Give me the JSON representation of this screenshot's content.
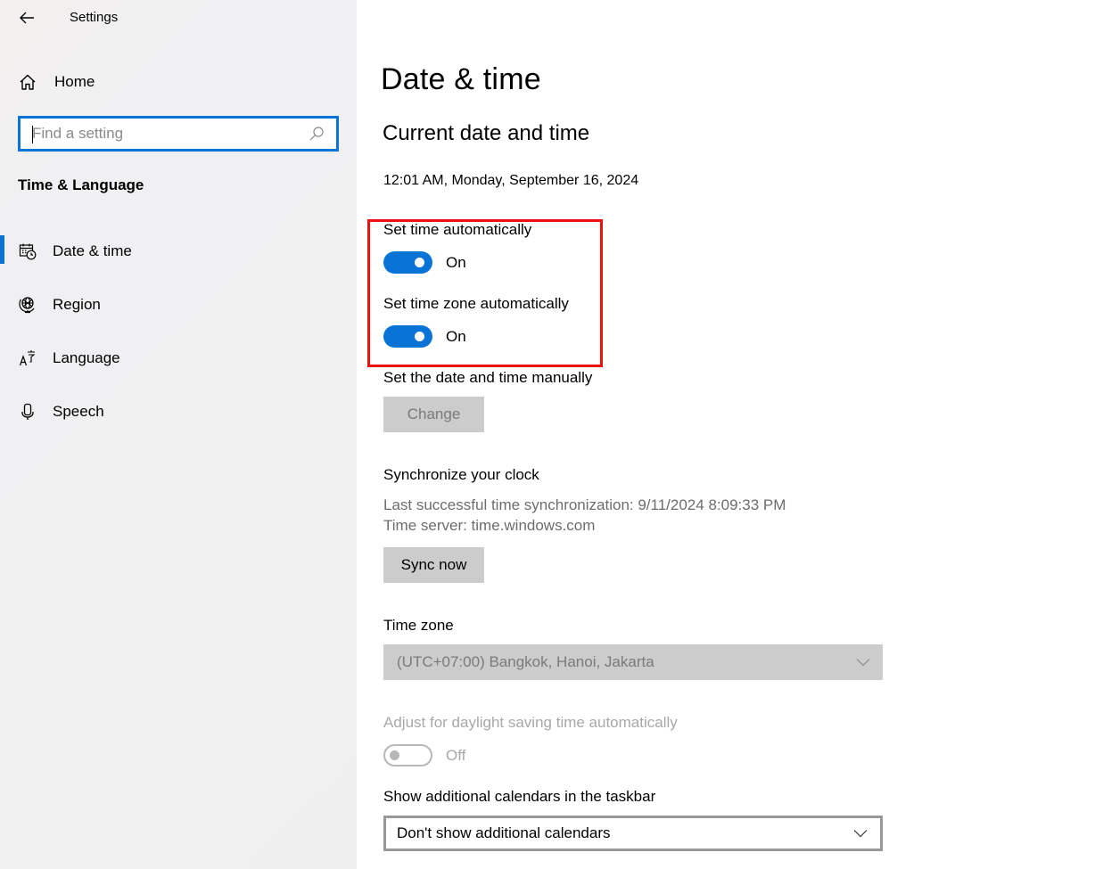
{
  "window": {
    "app_title": "Settings",
    "back_icon": "back-arrow-icon"
  },
  "sidebar": {
    "home": {
      "label": "Home",
      "icon": "home-icon"
    },
    "search": {
      "placeholder": "Find a setting",
      "value": "",
      "icon": "search-icon"
    },
    "section_title": "Time & Language",
    "items": [
      {
        "label": "Date & time",
        "icon": "calendar-clock-icon",
        "active": true
      },
      {
        "label": "Region",
        "icon": "globe-icon",
        "active": false
      },
      {
        "label": "Language",
        "icon": "language-icon",
        "active": false
      },
      {
        "label": "Speech",
        "icon": "microphone-icon",
        "active": false
      }
    ],
    "accent_color": "#0a74d6"
  },
  "main": {
    "page_title": "Date & time",
    "section_title": "Current date and time",
    "current_datetime": "12:01 AM, Monday, September 16, 2024",
    "set_time_auto": {
      "label": "Set time automatically",
      "state": "On",
      "enabled": true
    },
    "set_timezone_auto": {
      "label": "Set time zone automatically",
      "state": "On",
      "enabled": true
    },
    "manual": {
      "label": "Set the date and time manually",
      "button": "Change",
      "button_disabled": true
    },
    "sync": {
      "title": "Synchronize your clock",
      "last_sync": "Last successful time synchronization: 9/11/2024 8:09:33 PM",
      "server": "Time server: time.windows.com",
      "button": "Sync now"
    },
    "timezone": {
      "label": "Time zone",
      "value": "(UTC+07:00) Bangkok, Hanoi, Jakarta",
      "disabled": true
    },
    "dst": {
      "label": "Adjust for daylight saving time automatically",
      "state": "Off",
      "disabled": true
    },
    "calendars": {
      "label": "Show additional calendars in the taskbar",
      "value": "Don't show additional calendars"
    },
    "highlight_color": "#ee1111",
    "toggle_on_color": "#0a74d6"
  }
}
